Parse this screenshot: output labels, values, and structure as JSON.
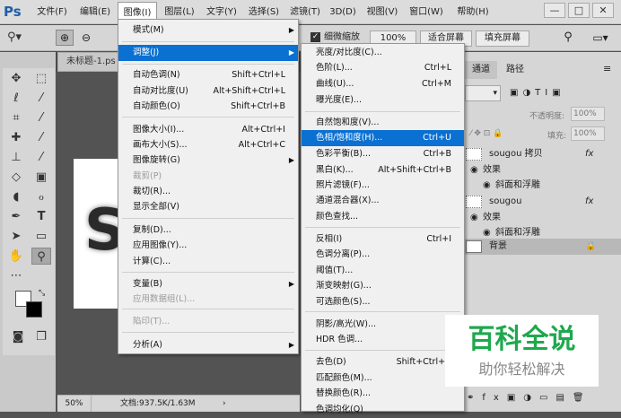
{
  "app": {
    "logo": "Ps"
  },
  "menubar": {
    "items": [
      "文件(F)",
      "编辑(E)",
      "图像(I)",
      "图层(L)",
      "文字(Y)",
      "选择(S)",
      "滤镜(T)",
      "3D(D)",
      "视图(V)",
      "窗口(W)",
      "帮助(H)"
    ]
  },
  "window_controls": {
    "minimize": "—",
    "restore": "□",
    "close": "✕"
  },
  "options": {
    "zoom_all_label": "细微缩放",
    "zoom_value": "100%",
    "fit_screen": "适合屏幕",
    "fill_screen": "填充屏幕"
  },
  "document": {
    "tab_title": "未标题-1.ps",
    "zoom": "50%",
    "doc_info": "文档:937.5K/1.63M"
  },
  "panels": {
    "tab_channels": "通道",
    "tab_paths": "路径",
    "opacity_label": "不透明度:",
    "opacity_value": "100%",
    "fill_label": "填充:",
    "fill_value": "100%"
  },
  "layers": [
    {
      "name": "sougou 拷贝",
      "fx": "fx"
    },
    {
      "name": "效果"
    },
    {
      "name": "斜面和浮雕"
    },
    {
      "name": "sougou",
      "fx": "fx"
    },
    {
      "name": "效果"
    },
    {
      "name": "斜面和浮雕"
    },
    {
      "name": "背景"
    }
  ],
  "image_menu": {
    "items": [
      {
        "label": "模式(M)",
        "shortcut": "",
        "submenu": true
      },
      {
        "label": "调整(J)",
        "shortcut": "",
        "submenu": true
      },
      {
        "label": "自动色调(N)",
        "shortcut": "Shift+Ctrl+L"
      },
      {
        "label": "自动对比度(U)",
        "shortcut": "Alt+Shift+Ctrl+L"
      },
      {
        "label": "自动颜色(O)",
        "shortcut": "Shift+Ctrl+B"
      },
      {
        "label": "图像大小(I)...",
        "shortcut": "Alt+Ctrl+I"
      },
      {
        "label": "画布大小(S)...",
        "shortcut": "Alt+Ctrl+C"
      },
      {
        "label": "图像旋转(G)",
        "shortcut": "",
        "submenu": true
      },
      {
        "label": "裁剪(P)",
        "shortcut": "",
        "disabled": true
      },
      {
        "label": "裁切(R)...",
        "shortcut": ""
      },
      {
        "label": "显示全部(V)",
        "shortcut": ""
      },
      {
        "label": "复制(D)...",
        "shortcut": ""
      },
      {
        "label": "应用图像(Y)...",
        "shortcut": ""
      },
      {
        "label": "计算(C)...",
        "shortcut": ""
      },
      {
        "label": "变量(B)",
        "shortcut": "",
        "submenu": true
      },
      {
        "label": "应用数据组(L)...",
        "shortcut": "",
        "disabled": true
      },
      {
        "label": "陷印(T)...",
        "shortcut": "",
        "disabled": true
      },
      {
        "label": "分析(A)",
        "shortcut": "",
        "submenu": true
      }
    ]
  },
  "adjust_menu": {
    "items": [
      {
        "label": "亮度/对比度(C)...",
        "shortcut": ""
      },
      {
        "label": "色阶(L)...",
        "shortcut": "Ctrl+L"
      },
      {
        "label": "曲线(U)...",
        "shortcut": "Ctrl+M"
      },
      {
        "label": "曝光度(E)...",
        "shortcut": ""
      },
      {
        "label": "自然饱和度(V)...",
        "shortcut": ""
      },
      {
        "label": "色相/饱和度(H)...",
        "shortcut": "Ctrl+U"
      },
      {
        "label": "色彩平衡(B)...",
        "shortcut": "Ctrl+B"
      },
      {
        "label": "黑白(K)...",
        "shortcut": "Alt+Shift+Ctrl+B"
      },
      {
        "label": "照片滤镜(F)...",
        "shortcut": ""
      },
      {
        "label": "通道混合器(X)...",
        "shortcut": ""
      },
      {
        "label": "颜色查找...",
        "shortcut": ""
      },
      {
        "label": "反相(I)",
        "shortcut": "Ctrl+I"
      },
      {
        "label": "色调分离(P)...",
        "shortcut": ""
      },
      {
        "label": "阈值(T)...",
        "shortcut": ""
      },
      {
        "label": "渐变映射(G)...",
        "shortcut": ""
      },
      {
        "label": "可选颜色(S)...",
        "shortcut": ""
      },
      {
        "label": "阴影/高光(W)...",
        "shortcut": ""
      },
      {
        "label": "HDR 色调...",
        "shortcut": ""
      },
      {
        "label": "去色(D)",
        "shortcut": "Shift+Ctrl+U"
      },
      {
        "label": "匹配颜色(M)...",
        "shortcut": ""
      },
      {
        "label": "替换颜色(R)...",
        "shortcut": ""
      },
      {
        "label": "色调均化(Q)",
        "shortcut": ""
      }
    ]
  },
  "watermark": {
    "title": "百科全说",
    "subtitle": "助你轻松解决"
  }
}
